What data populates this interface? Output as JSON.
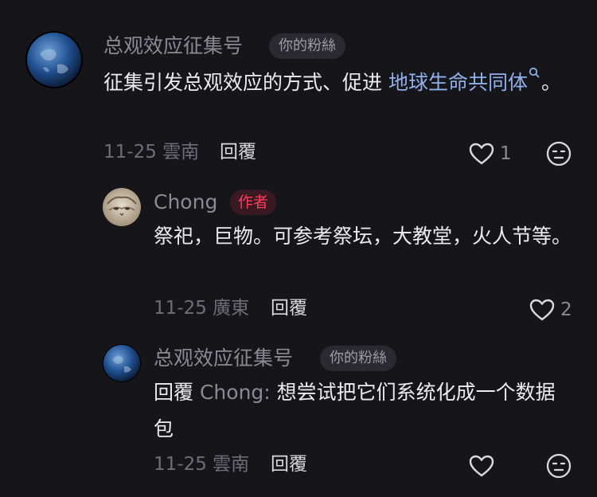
{
  "comments": [
    {
      "username": "总观效应征集号",
      "badge": "你的粉絲",
      "text_before": "征集引发总观效应的方式、促进 ",
      "topic": "地球生命共同体",
      "text_after": "。",
      "date": "11-25",
      "location": "雲南",
      "reply_label": "回覆",
      "like_count": "1",
      "like_icon": "heart-outline-icon",
      "dislike_icon": "dislike-face-icon"
    },
    {
      "username": "Chong",
      "badge": "作者",
      "text": "祭祀，巨物。可参考祭坛，大教堂，火人节等。",
      "date": "11-25",
      "location": "廣東",
      "reply_label": "回覆",
      "like_count": "2",
      "like_icon": "heart-outline-icon"
    },
    {
      "username": "总观效应征集号",
      "badge": "你的粉絲",
      "reply_prefix": "回覆",
      "reply_to": "Chong:",
      "text": "想尝试把它们系统化成一个数据包",
      "date": "11-25",
      "location": "雲南",
      "reply_label": "回覆",
      "like_icon": "heart-outline-icon",
      "dislike_icon": "dislike-face-icon"
    }
  ],
  "colors": {
    "background": "#161519",
    "link": "#8fb0ea",
    "author_badge": "#ff3b5c",
    "muted": "#8b8a93"
  }
}
